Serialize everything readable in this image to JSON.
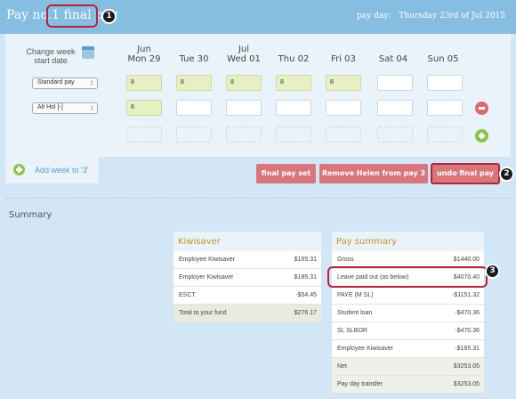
{
  "header": {
    "title_prefix": "Pay no.1",
    "title_main": "final pay",
    "pay_day_label": "pay day:",
    "pay_day_value": "Thursday 23rd of Jul 2015"
  },
  "callouts": [
    "1",
    "2",
    "3"
  ],
  "week_grid": {
    "change_week_label": "Change week start date",
    "days": [
      {
        "month": "Jun",
        "day": "Mon 29"
      },
      {
        "month": "",
        "day": "Tue 30"
      },
      {
        "month": "Jul",
        "day": "Wed 01"
      },
      {
        "month": "",
        "day": "Thu 02"
      },
      {
        "month": "",
        "day": "Fri 03"
      },
      {
        "month": "",
        "day": "Sat 04"
      },
      {
        "month": "",
        "day": "Sun 05"
      }
    ],
    "rows": [
      {
        "type": "Standard pay",
        "values": [
          "8",
          "8",
          "8",
          "8",
          "8",
          "",
          ""
        ]
      },
      {
        "type": "Alt Hol [-]",
        "values": [
          "8",
          "",
          "",
          "",
          "",
          "",
          ""
        ]
      }
    ]
  },
  "add_week_label": "Add week to '3'",
  "actions": {
    "final_pay_set": "final pay set",
    "remove": "Remove Helen from pay 3",
    "undo": "undo final pay"
  },
  "summary_title": "Summary",
  "kiwisaver": {
    "title": "Kiwisaver",
    "rows": [
      {
        "label": "Employee Kiwisaver",
        "value": "$165.31"
      },
      {
        "label": "Employer Kiwisaver",
        "value": "$185.31"
      },
      {
        "label": "ESCT",
        "value": "-$54.45"
      },
      {
        "label": "Total to your fund",
        "value": "$276.17"
      }
    ]
  },
  "pay_summary": {
    "title": "Pay summary",
    "rows": [
      {
        "label": "Gross",
        "value": "$1440.00"
      },
      {
        "label": "Leave paid out (as below)",
        "value": "$4070.40"
      },
      {
        "label": "PAYE (M SL)",
        "value": "-$1151.32"
      },
      {
        "label": "Student loan",
        "value": "-$470.36"
      },
      {
        "label": "SL SLBOR",
        "value": "-$470.36"
      },
      {
        "label": "Employee Kiwisaver",
        "value": "-$165.31"
      },
      {
        "label": "Net",
        "value": "$3253.05"
      },
      {
        "label": "Pay day transfer",
        "value": "$3253.05"
      }
    ]
  }
}
